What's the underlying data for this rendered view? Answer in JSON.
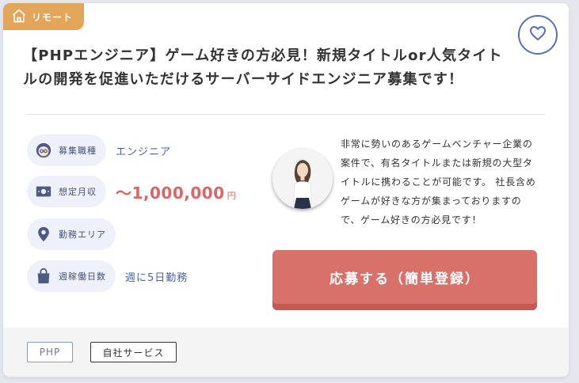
{
  "badge": {
    "label": "リモート",
    "icon": "home-icon"
  },
  "favorite": {
    "icon": "heart-icon"
  },
  "title": "【PHPエンジニア】ゲーム好きの方必見！新規タイトルor人気タイトルの開発を促進いただけるサーバーサイドエンジニア募集です！",
  "info": {
    "position": {
      "label": "募集職種",
      "value": "エンジニア",
      "icon": "person-glasses-icon"
    },
    "salary": {
      "label": "想定月収",
      "value": "〜1,000,000",
      "unit": "円",
      "icon": "money-icon"
    },
    "area": {
      "label": "勤務エリア",
      "value": "",
      "icon": "map-pin-icon"
    },
    "days": {
      "label": "週稼働日数",
      "value": "週に5日勤務",
      "icon": "bag-icon"
    }
  },
  "description": "非常に勢いのあるゲームベンチャー企業の案件で、有名タイトルまたは新規の大型タイトルに携わることが可能です。 社長含めゲームが好きな方が集まっておりますので、ゲーム好きの方必見です！",
  "apply_button": "応募する（簡単登録）",
  "tags": [
    "PHP",
    "自社サービス"
  ],
  "colors": {
    "badge": "#e3a55a",
    "accent_blue": "#4d62a5",
    "salary": "#d96565",
    "apply_button": "#d87169"
  }
}
